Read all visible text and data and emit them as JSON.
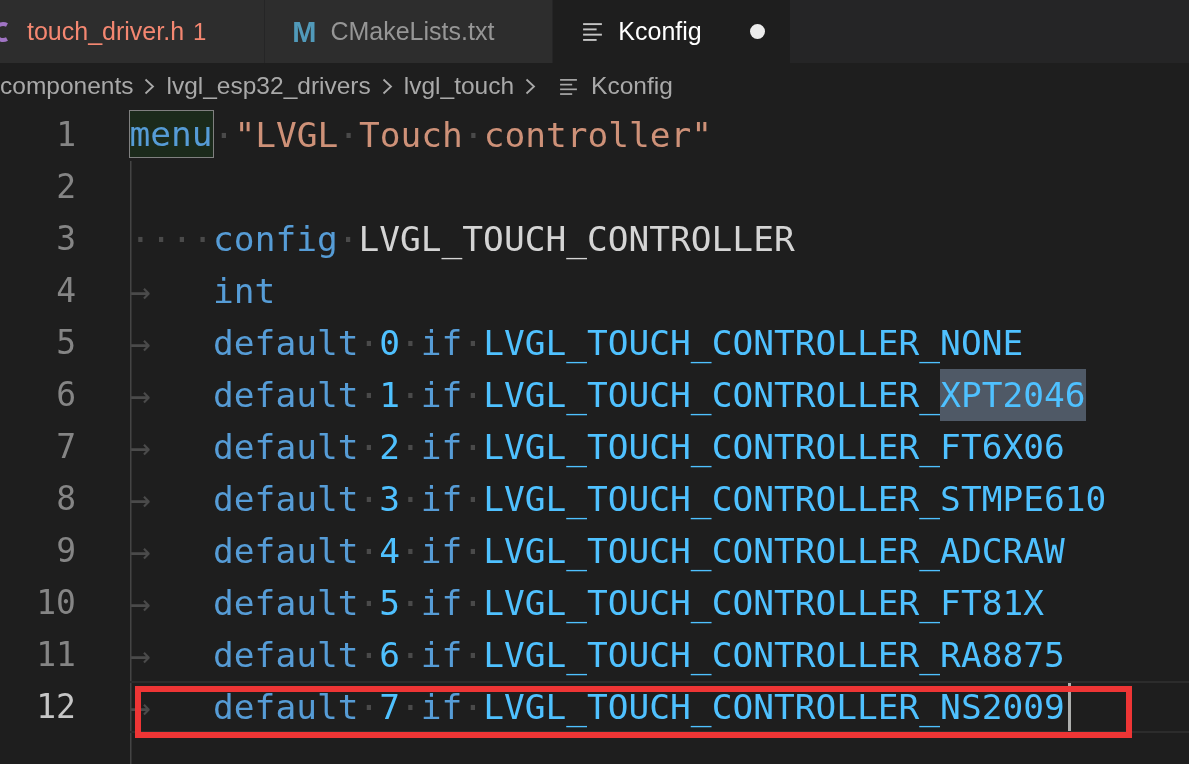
{
  "tabs": [
    {
      "kind": "c",
      "label": "touch_driver.h",
      "badge": "1",
      "error": true,
      "selected": false,
      "modified": false
    },
    {
      "kind": "cmake",
      "icon_label": "M",
      "label": "CMakeLists.txt",
      "error": false,
      "selected": false,
      "modified": false
    },
    {
      "kind": "kconfig",
      "label": "Kconfig",
      "error": false,
      "selected": true,
      "modified": true
    }
  ],
  "breadcrumb": [
    {
      "kind": "folder",
      "label": "components"
    },
    {
      "kind": "folder",
      "label": "lvgl_esp32_drivers"
    },
    {
      "kind": "folder",
      "label": "lvgl_touch"
    },
    {
      "kind": "file",
      "label": "Kconfig"
    }
  ],
  "lines": [
    {
      "number": "1",
      "current": false,
      "marked": false,
      "tokens": [
        {
          "kind": "framed",
          "text": "menu"
        },
        {
          "kind": "ws",
          "text": "·"
        },
        {
          "kind": "string",
          "text": "\"LVGL"
        },
        {
          "kind": "ws",
          "text": "·"
        },
        {
          "kind": "string",
          "text": "Touch"
        },
        {
          "kind": "ws",
          "text": "·"
        },
        {
          "kind": "string",
          "text": "controller\""
        }
      ]
    },
    {
      "number": "2",
      "current": false,
      "marked": false
    },
    {
      "number": "3",
      "current": false,
      "marked": false,
      "tokens": [
        {
          "kind": "ws",
          "text": "····"
        },
        {
          "kind": "keyword",
          "text": "config"
        },
        {
          "kind": "ws",
          "text": "·"
        },
        {
          "kind": "ident",
          "text": "LVGL_TOUCH_CONTROLLER"
        }
      ]
    },
    {
      "number": "4",
      "current": false,
      "marked": false,
      "tokens": [
        {
          "kind": "tab",
          "text": "→"
        },
        {
          "kind": "keyword",
          "text": "int"
        }
      ]
    },
    {
      "number": "5",
      "current": false,
      "marked": false,
      "tokens": [
        {
          "kind": "tab",
          "text": "→"
        },
        {
          "kind": "keyword",
          "text": "default"
        },
        {
          "kind": "ws",
          "text": "·"
        },
        {
          "kind": "constant",
          "text": "0"
        },
        {
          "kind": "ws",
          "text": "·"
        },
        {
          "kind": "keyword",
          "text": "if"
        },
        {
          "kind": "ws",
          "text": "·"
        },
        {
          "kind": "constant",
          "text": "LVGL_TOUCH_CONTROLLER_NONE"
        }
      ]
    },
    {
      "number": "6",
      "current": false,
      "marked": false,
      "tokens": [
        {
          "kind": "tab",
          "text": "→"
        },
        {
          "kind": "keyword",
          "text": "default"
        },
        {
          "kind": "ws",
          "text": "·"
        },
        {
          "kind": "constant",
          "text": "1"
        },
        {
          "kind": "ws",
          "text": "·"
        },
        {
          "kind": "keyword",
          "text": "if"
        },
        {
          "kind": "ws",
          "text": "·"
        },
        {
          "kind": "constant",
          "text": "LVGL_TOUCH_CONTROLLER_"
        },
        {
          "kind": "match",
          "text": "XPT2046"
        }
      ]
    },
    {
      "number": "7",
      "current": false,
      "marked": false,
      "tokens": [
        {
          "kind": "tab",
          "text": "→"
        },
        {
          "kind": "keyword",
          "text": "default"
        },
        {
          "kind": "ws",
          "text": "·"
        },
        {
          "kind": "constant",
          "text": "2"
        },
        {
          "kind": "ws",
          "text": "·"
        },
        {
          "kind": "keyword",
          "text": "if"
        },
        {
          "kind": "ws",
          "text": "·"
        },
        {
          "kind": "constant",
          "text": "LVGL_TOUCH_CONTROLLER_FT6X06"
        }
      ]
    },
    {
      "number": "8",
      "current": false,
      "marked": false,
      "tokens": [
        {
          "kind": "tab",
          "text": "→"
        },
        {
          "kind": "keyword",
          "text": "default"
        },
        {
          "kind": "ws",
          "text": "·"
        },
        {
          "kind": "constant",
          "text": "3"
        },
        {
          "kind": "ws",
          "text": "·"
        },
        {
          "kind": "keyword",
          "text": "if"
        },
        {
          "kind": "ws",
          "text": "·"
        },
        {
          "kind": "constant",
          "text": "LVGL_TOUCH_CONTROLLER_STMPE610"
        }
      ]
    },
    {
      "number": "9",
      "current": false,
      "marked": false,
      "tokens": [
        {
          "kind": "tab",
          "text": "→"
        },
        {
          "kind": "keyword",
          "text": "default"
        },
        {
          "kind": "ws",
          "text": "·"
        },
        {
          "kind": "constant",
          "text": "4"
        },
        {
          "kind": "ws",
          "text": "·"
        },
        {
          "kind": "keyword",
          "text": "if"
        },
        {
          "kind": "ws",
          "text": "·"
        },
        {
          "kind": "constant",
          "text": "LVGL_TOUCH_CONTROLLER_ADCRAW"
        }
      ]
    },
    {
      "number": "10",
      "current": false,
      "marked": false,
      "tokens": [
        {
          "kind": "tab",
          "text": "→"
        },
        {
          "kind": "keyword",
          "text": "default"
        },
        {
          "kind": "ws",
          "text": "·"
        },
        {
          "kind": "constant",
          "text": "5"
        },
        {
          "kind": "ws",
          "text": "·"
        },
        {
          "kind": "keyword",
          "text": "if"
        },
        {
          "kind": "ws",
          "text": "·"
        },
        {
          "kind": "constant",
          "text": "LVGL_TOUCH_CONTROLLER_FT81X"
        }
      ]
    },
    {
      "number": "11",
      "current": false,
      "marked": false,
      "tokens": [
        {
          "kind": "tab",
          "text": "→"
        },
        {
          "kind": "keyword",
          "text": "default"
        },
        {
          "kind": "ws",
          "text": "·"
        },
        {
          "kind": "constant",
          "text": "6"
        },
        {
          "kind": "ws",
          "text": "·"
        },
        {
          "kind": "keyword",
          "text": "if"
        },
        {
          "kind": "ws",
          "text": "·"
        },
        {
          "kind": "constant",
          "text": "LVGL_TOUCH_CONTROLLER_RA8875"
        }
      ]
    },
    {
      "number": "12",
      "current": true,
      "marked": true,
      "tokens": [
        {
          "kind": "tab",
          "text": "→"
        },
        {
          "kind": "keyword",
          "text": "default"
        },
        {
          "kind": "ws",
          "text": "·"
        },
        {
          "kind": "constant",
          "text": "7"
        },
        {
          "kind": "ws",
          "text": "·"
        },
        {
          "kind": "keyword",
          "text": "if"
        },
        {
          "kind": "ws",
          "text": "·"
        },
        {
          "kind": "constant",
          "text": "LVGL_TOUCH_CONTROLLER_NS2009"
        }
      ]
    }
  ]
}
